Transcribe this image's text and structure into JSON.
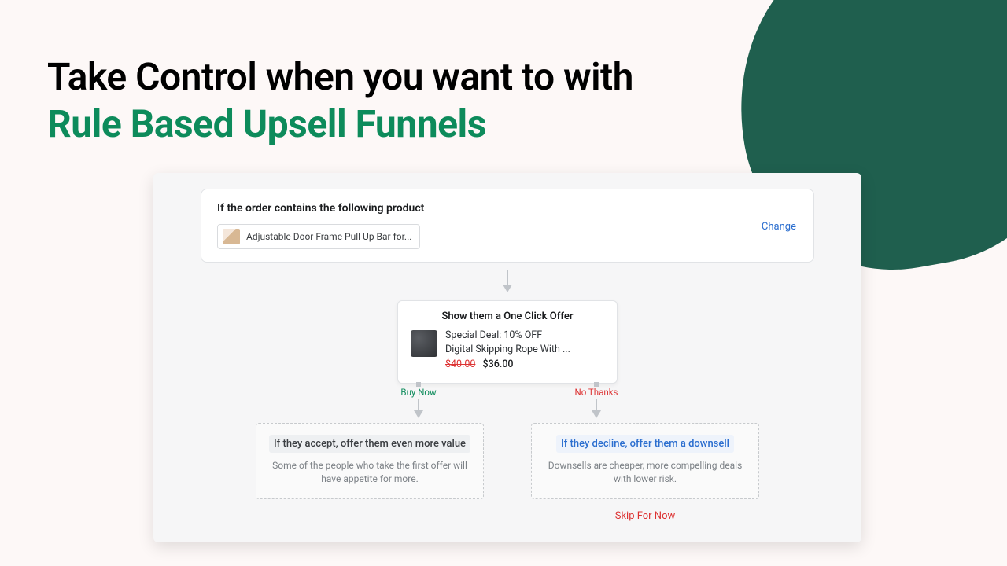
{
  "headline": {
    "line1": "Take Control when you want to with",
    "line2": "Rule Based Upsell Funnels"
  },
  "trigger": {
    "title": "If the order contains the following product",
    "product_name": "Adjustable Door Frame Pull Up Bar for...",
    "change_label": "Change"
  },
  "offer": {
    "title": "Show them a One Click Offer",
    "deal_line": "Special Deal: 10% OFF",
    "product_line": "Digital Skipping Rope With ...",
    "old_price": "$40.00",
    "new_price": "$36.00"
  },
  "branches": {
    "buy_label": "Buy Now",
    "no_label": "No Thanks"
  },
  "accept": {
    "heading": "If they accept, offer them even more value",
    "desc": "Some of the people who take the first offer will have appetite for more."
  },
  "decline": {
    "heading": "If they decline, offer them a downsell",
    "desc": "Downsells are cheaper, more compelling deals with lower risk."
  },
  "skip_label": "Skip For Now"
}
